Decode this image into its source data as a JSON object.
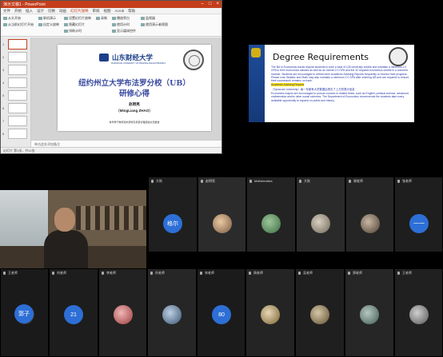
{
  "ppt": {
    "titlebar": "演示文稿1 - PowerPoint",
    "tabs": [
      "文件",
      "开始",
      "插入",
      "设计",
      "切换",
      "动画",
      "幻灯片放映",
      "审阅",
      "视图",
      "Acrob",
      "帮助"
    ],
    "ribbon": [
      "从头开始",
      "从当前幻灯片开始",
      "联机演示",
      "自定义放映",
      "设置幻灯片放映",
      "隐藏幻灯片",
      "排练计时",
      "录制",
      "播放旁白",
      "使用计时",
      "显示媒体控件",
      "监视器",
      "使用演示者视图"
    ],
    "thumb_numbers": [
      "1",
      "2",
      "3",
      "4",
      "5",
      "6",
      "7",
      "8",
      "9",
      "10",
      "11"
    ],
    "notes_placeholder": "单击此处添加备注",
    "status": "幻灯片 第1张，共11张",
    "slide": {
      "university_name": "山东财经大学",
      "university_en": "SHANDONG UNIVERSITY OF FINANCE AND ECONOMICS",
      "title_line1": "纽约州立大学布法罗分校（UB）",
      "title_line2": "研修心得",
      "author": "赵明亮",
      "author_en": "（MingLiang ZHAO）",
      "footer": "青年骨干教师海外研修及项目管理经验交流报告"
    }
  },
  "right_slide": {
    "heading": "Degree Requirements",
    "paragraphs": [
      "The BA in Economics tracks require students to earn a total of 128 university credits and maintain a minimum 2.0 GPA in their economics classes as well as an overall 2.0 GPA and the 32 required economics credits in a coherent manner. Students are encouraged to refresh their Academic Advising Reports frequently to monitor their progress. Please note Statistic and Math may also maintain a minimum 2.0 GPA after entering UB and are required to ensure their coursework remains on track.",
      "（Syracuse University）每一年都有大学数据后再去了上方的提示信息",
      "Economics majors are encouraged to pursue courses in related fields, such as English, political science, advanced mathematics and/or other social sciences. The Department of Economics recommends the students take every available opportunity to expand on public and history."
    ],
    "highlight": "Academic Advising Reports"
  },
  "participants": [
    {
      "name": "大秋",
      "avatar": "格尔"
    },
    {
      "name": "赵明亮",
      "avatar": ""
    },
    {
      "name": "Mathematics",
      "avatar": ""
    },
    {
      "name": "大秋",
      "avatar": ""
    },
    {
      "name": "谢老师",
      "avatar": ""
    },
    {
      "name": "张老师",
      "avatar": "一一"
    },
    {
      "name": "王老师",
      "avatar": ""
    },
    {
      "name": "刘老师",
      "avatar": ""
    },
    {
      "name": "李老师",
      "avatar": ""
    },
    {
      "name": "孙老师",
      "avatar": ""
    },
    {
      "name": "陈老师",
      "avatar": "郭子"
    },
    {
      "name": "18",
      "avatar": "21"
    },
    {
      "name": "宋老师",
      "avatar": ""
    },
    {
      "name": "周老师",
      "avatar": ""
    },
    {
      "name": "马老师",
      "avatar": "80"
    },
    {
      "name": "吴老师",
      "avatar": ""
    },
    {
      "name": "郑老师",
      "avatar": ""
    },
    {
      "name": "王老师",
      "avatar": ""
    },
    {
      "name": "冯老师",
      "avatar": ""
    }
  ]
}
